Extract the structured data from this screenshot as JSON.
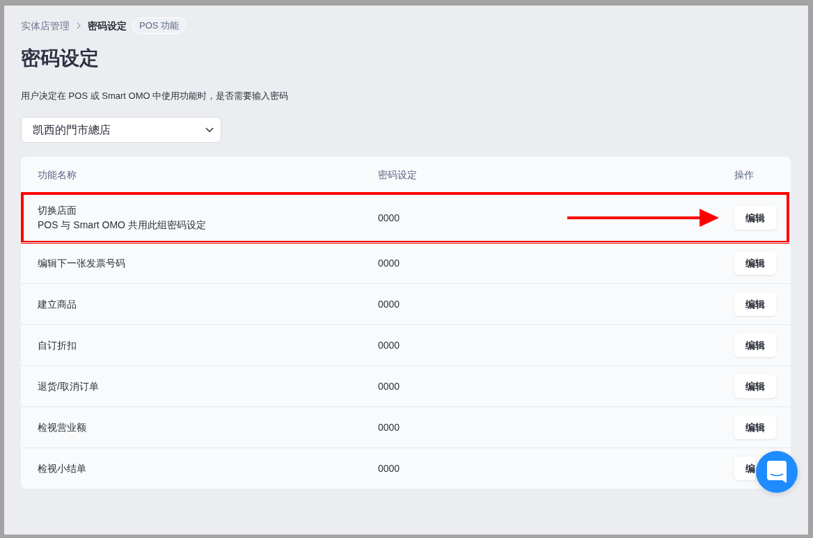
{
  "breadcrumb": {
    "items": [
      {
        "label": "实体店管理",
        "current": false
      },
      {
        "label": "密码设定",
        "current": true
      }
    ],
    "badge": "POS 功能"
  },
  "title": "密码设定",
  "description": "用户决定在 POS 或 Smart OMO 中使用功能时，是否需要输入密码",
  "store_select": {
    "value": "凯西的門市總店"
  },
  "table": {
    "columns": [
      "功能名称",
      "密码设定",
      "操作"
    ],
    "rows": [
      {
        "name": "切换店面",
        "note": "POS 与 Smart OMO 共用此组密码设定",
        "password": "0000",
        "action": "编辑",
        "highlighted": true
      },
      {
        "name": "编辑下一张发票号码",
        "password": "0000",
        "action": "编辑",
        "highlighted": false
      },
      {
        "name": "建立商品",
        "password": "0000",
        "action": "编辑",
        "highlighted": false
      },
      {
        "name": "自订折扣",
        "password": "0000",
        "action": "编辑",
        "highlighted": false
      },
      {
        "name": "退货/取消订单",
        "password": "0000",
        "action": "编辑",
        "highlighted": false
      },
      {
        "name": "检视营业额",
        "password": "0000",
        "action": "编辑",
        "highlighted": false
      },
      {
        "name": "检视小结单",
        "password": "0000",
        "action": "编",
        "highlighted": false
      }
    ]
  }
}
